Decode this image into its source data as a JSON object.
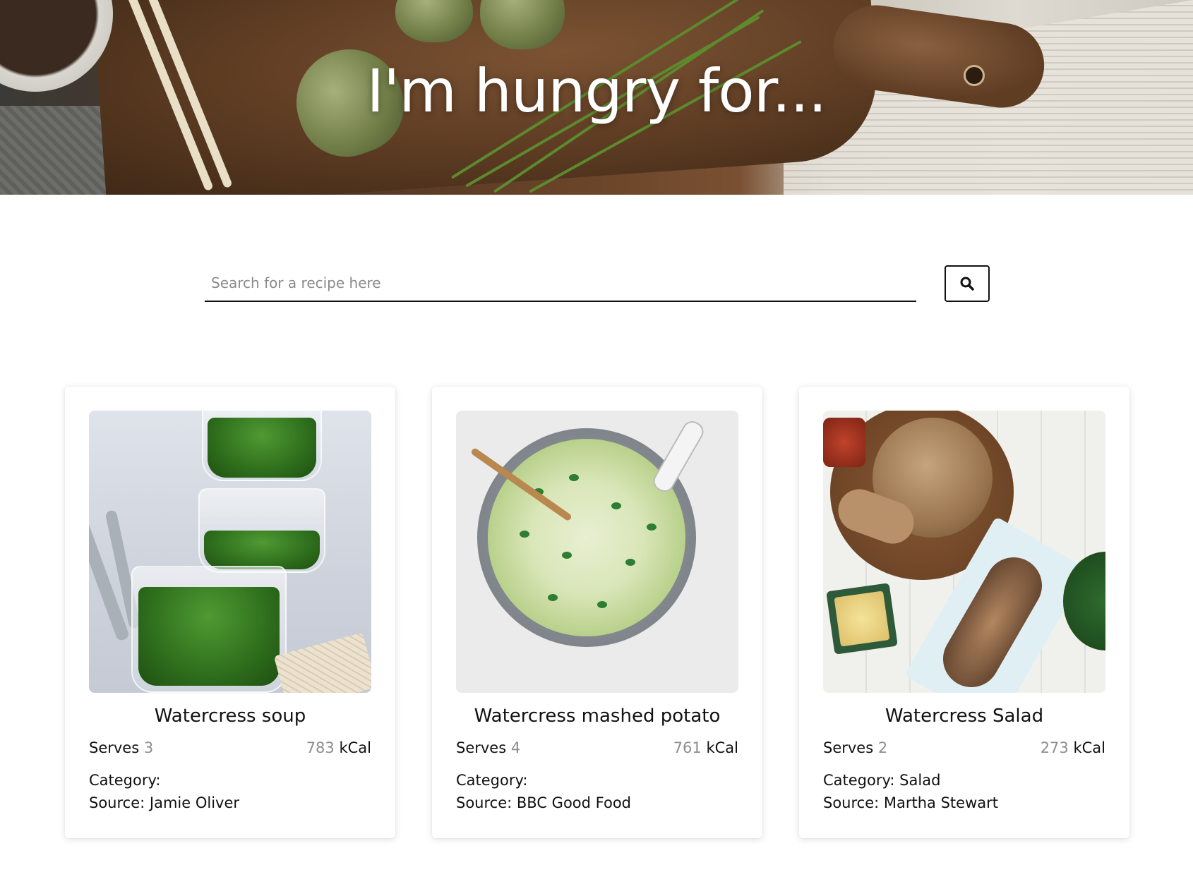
{
  "hero": {
    "title": "I'm hungry for..."
  },
  "search": {
    "placeholder": "Search for a recipe here",
    "button_icon": "search-icon"
  },
  "recipes": [
    {
      "title": "Watercress soup",
      "serves_label": "Serves",
      "serves": "3",
      "kcal": "783",
      "kcal_unit": "kCal",
      "category_label": "Category:",
      "category": "",
      "source_label": "Source:",
      "source": "Jamie Oliver"
    },
    {
      "title": "Watercress mashed potato",
      "serves_label": "Serves",
      "serves": "4",
      "kcal": "761",
      "kcal_unit": "kCal",
      "category_label": "Category:",
      "category": "",
      "source_label": "Source:",
      "source": "BBC Good Food"
    },
    {
      "title": "Watercress Salad",
      "serves_label": "Serves",
      "serves": "2",
      "kcal": "273",
      "kcal_unit": "kCal",
      "category_label": "Category:",
      "category": "Salad",
      "source_label": "Source:",
      "source": "Martha Stewart"
    }
  ]
}
